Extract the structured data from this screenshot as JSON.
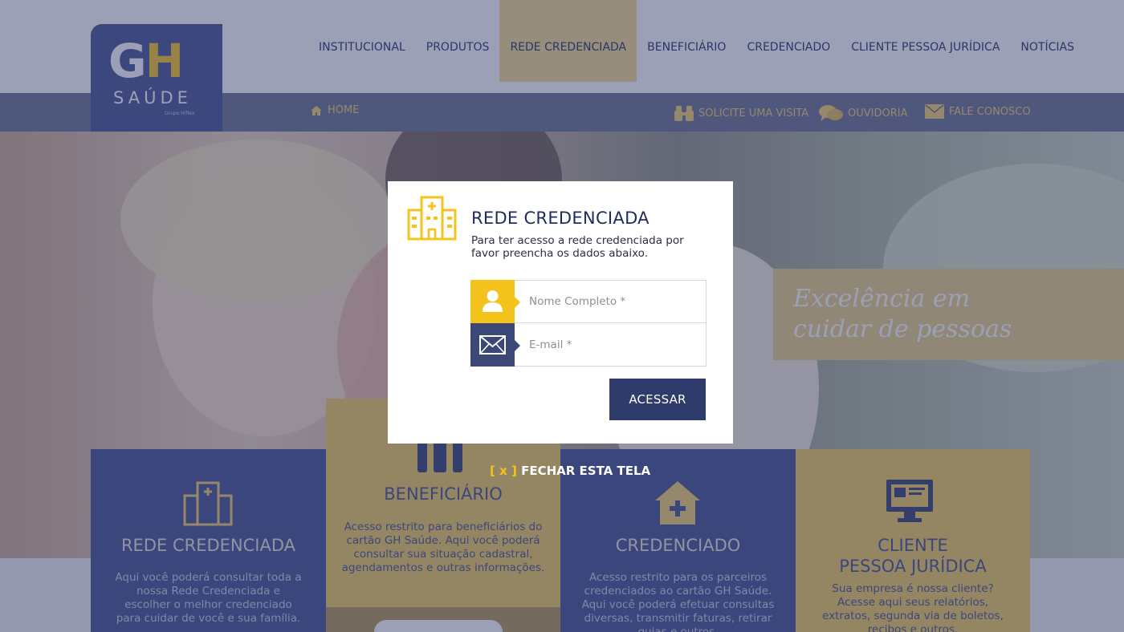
{
  "brand": {
    "logo_main": "GH",
    "logo_plus": "+",
    "logo_sub": "SAÚDE",
    "logo_group": "Grupo Hiflex"
  },
  "main_nav": [
    {
      "label": "INSTITUCIONAL",
      "active": false
    },
    {
      "label": "PRODUTOS",
      "active": false
    },
    {
      "label": "REDE CREDENCIADA",
      "active": true
    },
    {
      "label": "BENEFICIÁRIO",
      "active": false
    },
    {
      "label": "CREDENCIADO",
      "active": false
    },
    {
      "label": "CLIENTE PESSOA JURÍDICA",
      "active": false
    },
    {
      "label": "NOTÍCIAS",
      "active": false
    }
  ],
  "sub_nav": {
    "home": "HOME",
    "visit": "SOLICITE UMA VISITA",
    "ombudsman": "OUVIDORIA",
    "contact": "FALE CONOSCO"
  },
  "hero": {
    "tagline_line1": "Excelência em",
    "tagline_line2": "cuidar de pessoas"
  },
  "cards": [
    {
      "title": "REDE CREDENCIADA",
      "desc": "Aqui você poderá consultar toda a nossa Rede Credenciada e escolher o melhor credenciado para cuidar de você e sua família."
    },
    {
      "title": "BENEFICIÁRIO",
      "desc": "Acesso restrito para beneficiários do cartão GH Saúde. Aqui você poderá consultar sua situação cadastral, agendamentos e outras informações."
    },
    {
      "title": "CREDENCIADO",
      "desc": "Acesso restrito para os parceiros credenciados ao cartão GH Saúde. Aqui você poderá efetuar consultas diversas, transmitir faturas, retirar guias e outros."
    },
    {
      "title_line1": "CLIENTE",
      "title_line2": "PESSOA JURÍDICA",
      "desc": "Sua empresa é nossa cliente? Acesse aqui seus relatórios, extratos, segunda via de boletos, recibos e outros."
    }
  ],
  "modal": {
    "title": "REDE CREDENCIADA",
    "text": "Para ter acesso a rede credenciada por favor preencha os dados abaixo.",
    "name_placeholder": "Nome Completo *",
    "email_placeholder": "E-mail *",
    "submit_label": "ACESSAR"
  },
  "close": {
    "x_label": "[ x ]",
    "label": "FECHAR ESTA TELA"
  },
  "colors": {
    "navy": "#3d4a8b",
    "gold": "#f4c31b",
    "button": "#2e3b6b"
  }
}
